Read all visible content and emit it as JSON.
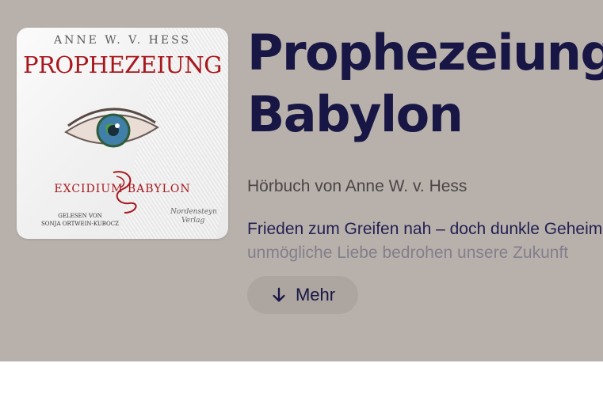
{
  "cover": {
    "author": "ANNE W. V. HESS",
    "title": "PROPHEZEIUNG",
    "subtitle": "EXCIDIUM BABYLON",
    "reader_line1": "GELESEN VON",
    "reader_line2": "SONJA ORTWEIN-KUBOCZ",
    "publisher_line1": "Nordensteyn",
    "publisher_line2": "Verlag"
  },
  "book": {
    "title_line1": "Prophezeiung -",
    "title_line2": "Babylon",
    "author_line": "Hörbuch von Anne W. v. Hess",
    "description_line1": "Frieden zum Greifen nah – doch dunkle Geheimnisse",
    "description_line2": "unmögliche Liebe bedrohen unsere Zukunft"
  },
  "more_button": {
    "label": "Mehr",
    "icon": "arrow-down-icon"
  },
  "colors": {
    "hero_background": "#b8b1ab",
    "title": "#181644",
    "accent_red": "#a8171d"
  }
}
